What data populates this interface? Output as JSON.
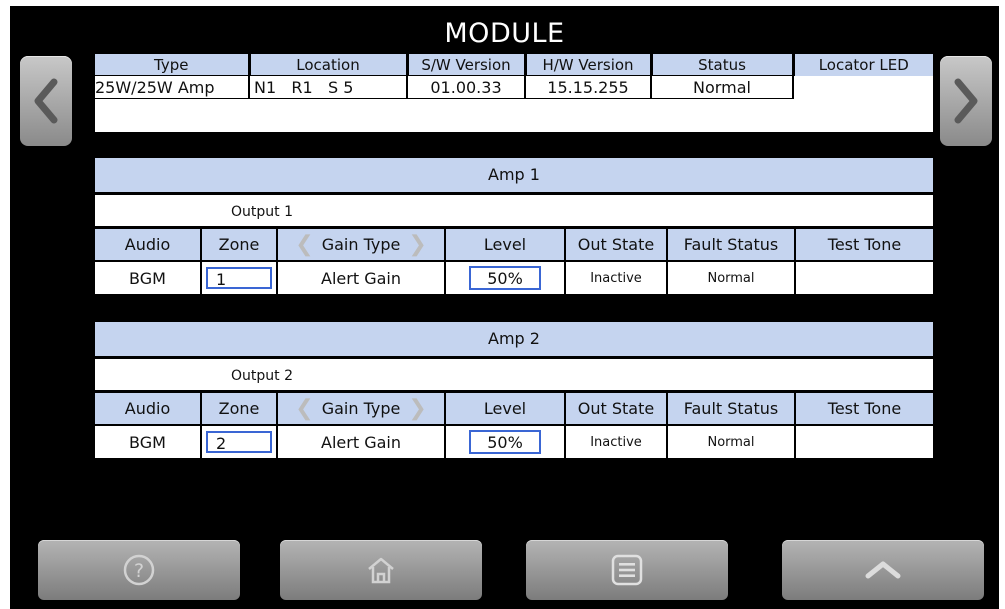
{
  "title": "MODULE",
  "module": {
    "headers": [
      "Type",
      "Location",
      "S/W Version",
      "H/W Version",
      "Status",
      "Locator LED"
    ],
    "row": {
      "type": "25W/25W Amp",
      "loc_n": "N1",
      "loc_r": "R1",
      "loc_s": "S 5",
      "sw_version": "01.00.33",
      "hw_version": "15.15.255",
      "status": "Normal"
    }
  },
  "column_headers": {
    "audio": "Audio",
    "zone": "Zone",
    "gain_type": "Gain Type",
    "level": "Level",
    "out_state": "Out State",
    "fault_status": "Fault Status",
    "test_tone": "Test Tone"
  },
  "amps": [
    {
      "title": "Amp 1",
      "output": "Output 1",
      "audio": "BGM",
      "zone": "1",
      "gain_type": "Alert Gain",
      "level": "50%",
      "out_state": "Inactive",
      "fault_status": "Normal",
      "test_tone": ""
    },
    {
      "title": "Amp 2",
      "output": "Output 2",
      "audio": "BGM",
      "zone": "2",
      "gain_type": "Alert Gain",
      "level": "50%",
      "out_state": "Inactive",
      "fault_status": "Normal",
      "test_tone": ""
    }
  ],
  "icons": {
    "prev": "chevron-left-icon",
    "next": "chevron-right-icon",
    "help": "help-icon",
    "home": "home-icon",
    "menu": "menu-icon",
    "up": "chevron-up-icon"
  },
  "colors": {
    "header_bg": "#c5d4ef",
    "focus_border": "#3a66d4",
    "background": "#000000"
  }
}
